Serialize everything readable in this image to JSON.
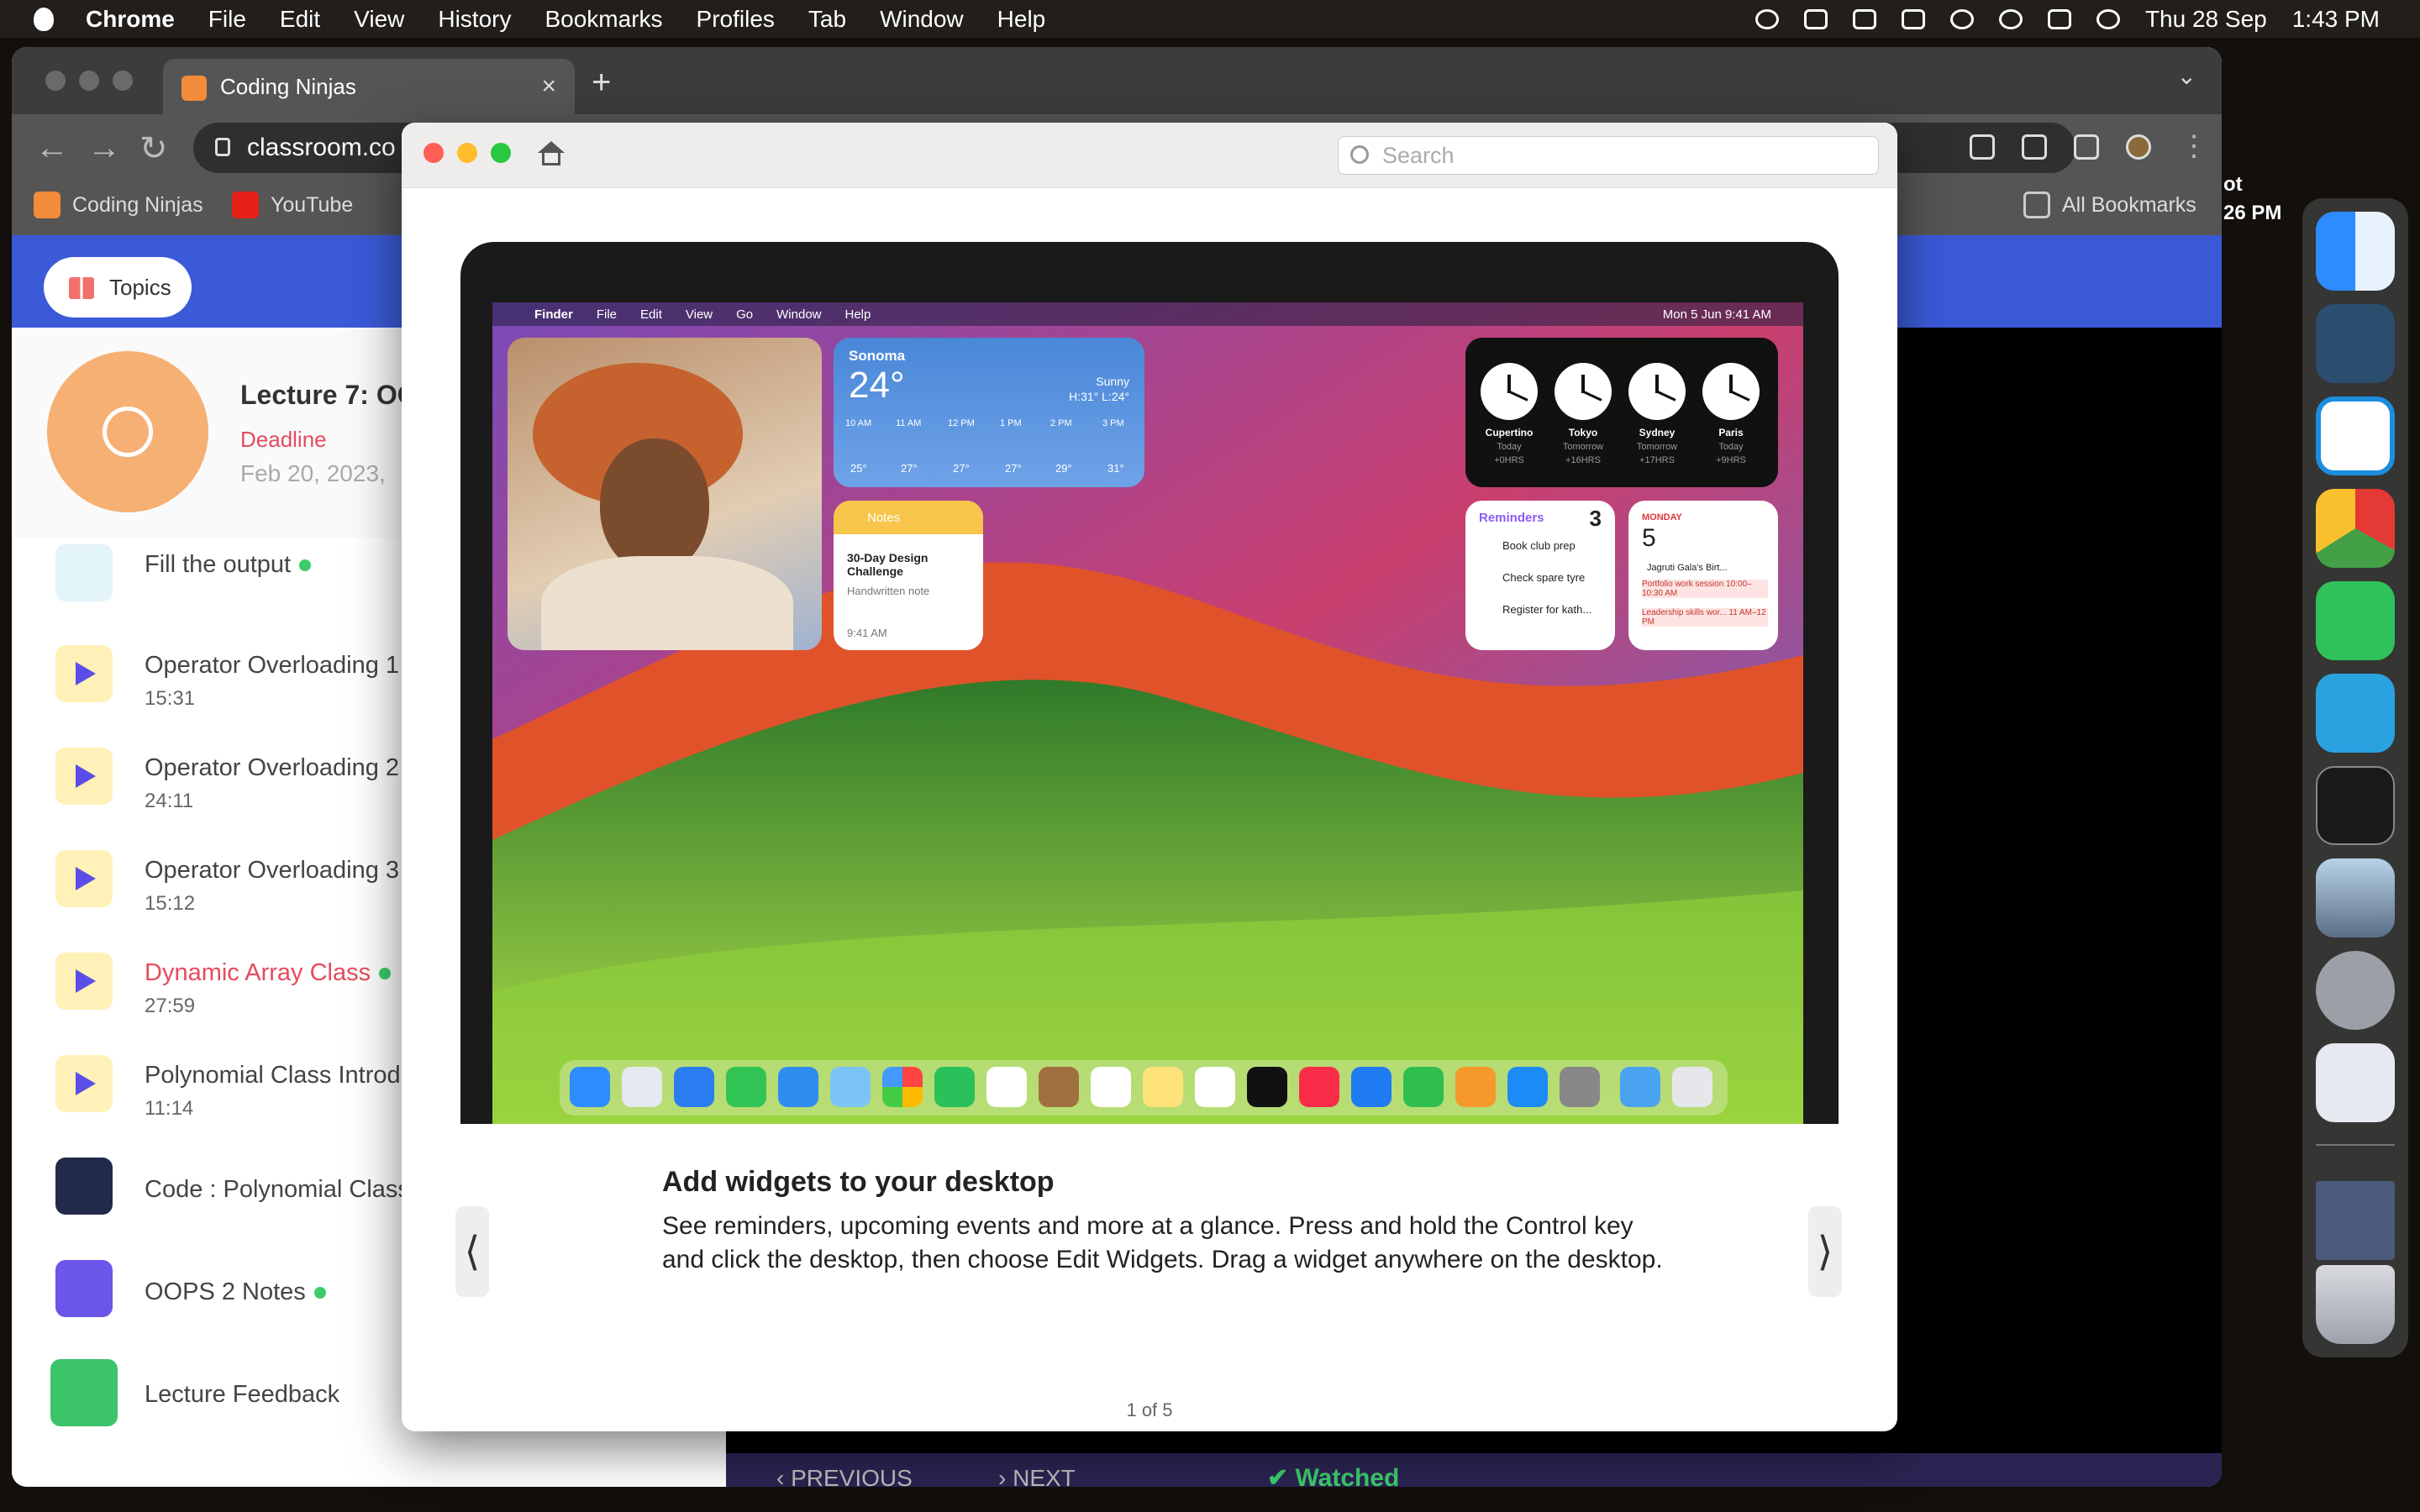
{
  "menubar": {
    "app": "Chrome",
    "items": [
      "File",
      "Edit",
      "View",
      "History",
      "Bookmarks",
      "Profiles",
      "Tab",
      "Window",
      "Help"
    ],
    "date": "Thu 28 Sep",
    "time": "1:43 PM"
  },
  "browser": {
    "tab_title": "Coding Ninjas",
    "url": "classroom.co",
    "bookmarks": [
      "Coding Ninjas",
      "YouTube"
    ],
    "all_bookmarks": "All Bookmarks"
  },
  "page": {
    "topics_label": "Topics",
    "lecture": {
      "title": "Lecture 7: OO",
      "deadline_label": "Deadline",
      "date": "Feb 20, 2023,"
    },
    "items": [
      {
        "title": "Fill the output",
        "duration": "",
        "icon": "puzzle-icon",
        "done": true
      },
      {
        "title": "Operator Overloading 1",
        "duration": "15:31",
        "icon": "play-icon",
        "done": false
      },
      {
        "title": "Operator Overloading 2",
        "duration": "24:11",
        "icon": "play-icon",
        "done": false
      },
      {
        "title": "Operator Overloading 3",
        "duration": "15:12",
        "icon": "play-icon",
        "done": false
      },
      {
        "title": "Dynamic Array Class",
        "duration": "27:59",
        "icon": "play-icon",
        "done": true,
        "active": true
      },
      {
        "title": "Polynomial Class Introd",
        "duration": "11:14",
        "icon": "play-icon",
        "done": false
      },
      {
        "title": "Code : Polynomial Class",
        "duration": "",
        "icon": "terminal-icon",
        "done": false
      },
      {
        "title": "OOPS 2 Notes",
        "duration": "",
        "icon": "notes-icon",
        "done": true
      },
      {
        "title": "Lecture Feedback",
        "duration": "",
        "icon": "smile-icon",
        "done": false
      }
    ],
    "bottom_nav": {
      "previous": "PREVIOUS",
      "next": "NEXT",
      "watched": "Watched"
    }
  },
  "side_text": {
    "line1": "ot",
    "line2": "26 PM"
  },
  "tips": {
    "search_placeholder": "Search",
    "title": "Add widgets to your desktop",
    "body": "See reminders, upcoming events and more at a glance. Press and hold the Control key and click the desktop, then choose Edit Widgets. Drag a widget anywhere on the desktop.",
    "page_indicator": "1 of 5",
    "prev": "⟨",
    "next": "⟩",
    "preview": {
      "menu": [
        "Finder",
        "File",
        "Edit",
        "View",
        "Go",
        "Window",
        "Help"
      ],
      "time": "Mon 5 Jun  9:41 AM",
      "weather": {
        "city": "Sonoma",
        "temp": "24°",
        "cond": "Sunny",
        "hl": "H:31° L:24°",
        "hours": [
          "10 AM",
          "11 AM",
          "12 PM",
          "1 PM",
          "2 PM",
          "3 PM"
        ],
        "temps": [
          "25°",
          "27°",
          "27°",
          "27°",
          "29°",
          "31°"
        ]
      },
      "notes": {
        "header": "Notes",
        "title": "30-Day Design Challenge",
        "sub": "Handwritten note",
        "time": "9:41 AM"
      },
      "clocks": [
        {
          "city": "Cupertino",
          "day": "Today",
          "off": "+0HRS"
        },
        {
          "city": "Tokyo",
          "day": "Tomorrow",
          "off": "+16HRS"
        },
        {
          "city": "Sydney",
          "day": "Tomorrow",
          "off": "+17HRS"
        },
        {
          "city": "Paris",
          "day": "Today",
          "off": "+9HRS"
        }
      ],
      "reminders": {
        "title": "Reminders",
        "count": "3",
        "items": [
          "Book club prep",
          "Check spare tyre",
          "Register for kath..."
        ]
      },
      "calendar": {
        "day": "MONDAY",
        "date": "5",
        "events": [
          "Jagruti Gala's Birt...",
          "Portfolio work session 10:00–10:30 AM",
          "Leadership skills wor... 11 AM–12 PM"
        ]
      }
    }
  },
  "colors": {
    "accent": "#3b5ad8",
    "active_item": "#e54b5e",
    "done_dot": "#3ccc6a"
  }
}
